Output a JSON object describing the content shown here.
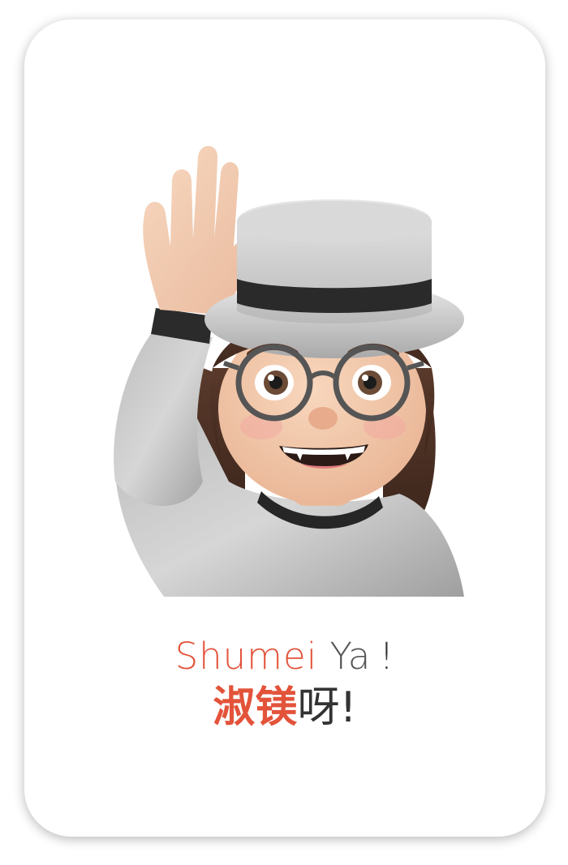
{
  "greeting": {
    "english": {
      "name": "Shumei",
      "particle": "Ya",
      "exclamation": "!"
    },
    "chinese": {
      "name": "淑镁",
      "particle": "呀",
      "exclamation": "!"
    }
  },
  "avatar": {
    "icon": "waving-memoji-icon"
  },
  "colors": {
    "accent": "#e3533a",
    "text": "#333333",
    "card_background": "#ffffff"
  }
}
